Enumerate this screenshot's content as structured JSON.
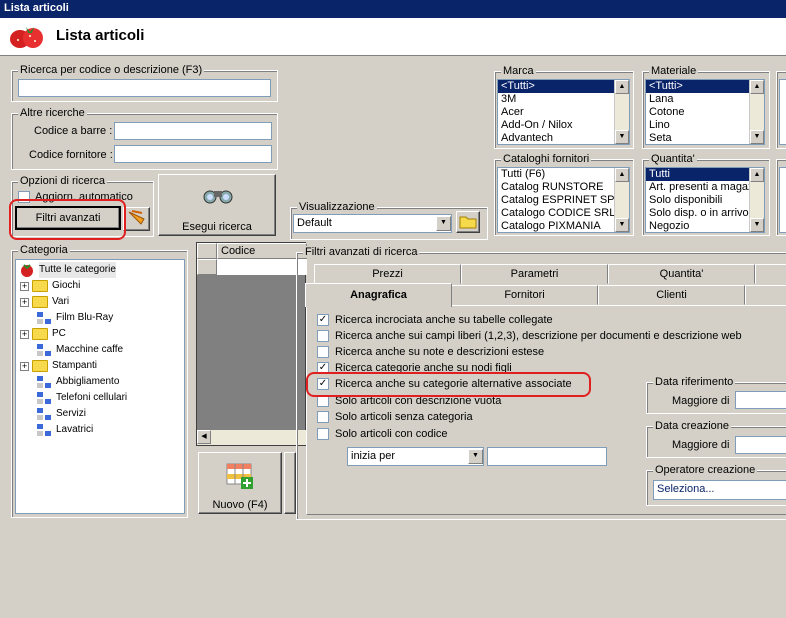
{
  "window": {
    "title": "Lista articoli"
  },
  "header": {
    "title": "Lista articoli"
  },
  "search": {
    "legend": "Ricerca per codice o descrizione (F3)",
    "value": ""
  },
  "altre": {
    "legend": "Altre ricerche",
    "barcode_label": "Codice a barre :",
    "supplier_label": "Codice fornitore :"
  },
  "opzioni": {
    "legend": "Opzioni di ricerca",
    "auto_update": "Aggiorn. automatico",
    "filtri_button": "Filtri avanzati"
  },
  "actions": {
    "esegui": "Esegui ricerca",
    "nuovo": "Nuovo (F4)"
  },
  "visual": {
    "legend": "Visualizzazione",
    "value": "Default"
  },
  "marca": {
    "legend": "Marca",
    "items": [
      "<Tutti>",
      "3M",
      "Acer",
      "Add-On / Nilox",
      "Advantech"
    ]
  },
  "materiale": {
    "legend": "Materiale",
    "items": [
      "<Tutti>",
      "Lana",
      "Cotone",
      "Lino",
      "Seta"
    ]
  },
  "cataloghi": {
    "legend": "Cataloghi fornitori",
    "items": [
      "Tutti (F6)",
      "Catalog RUNSTORE",
      "Catalog ESPRINET SP",
      "Catalogo CODICE SRL",
      "Catalogo PIXMANIA"
    ]
  },
  "quantita": {
    "legend": "Quantita'",
    "items": [
      "Tutti",
      "Art. presenti a magaz",
      "Solo disponibili",
      "Solo disp. o in arrivo",
      "Negozio"
    ]
  },
  "categoria": {
    "legend": "Categoria",
    "root": "Tutte le categorie",
    "items": [
      "Giochi",
      "Vari",
      "Film Blu-Ray",
      "PC",
      "Macchine caffe",
      "Stampanti",
      "Abbigliamento",
      "Telefoni cellulari",
      "Servizi",
      "Lavatrici"
    ]
  },
  "grid": {
    "col_codice": "Codice"
  },
  "filtri": {
    "legend": "Filtri avanzati di ricerca",
    "tabs_back": [
      "Prezzi",
      "Parametri",
      "Quantita'"
    ],
    "tabs_front": [
      "Anagrafica",
      "Fornitori",
      "Clienti"
    ],
    "options": [
      {
        "label": "Ricerca incrociata anche su tabelle collegate",
        "checked": true
      },
      {
        "label": "Ricerca anche sui campi liberi (1,2,3), descrizione per documenti e descrizione web",
        "checked": false
      },
      {
        "label": "Ricerca anche su note e descrizioni estese",
        "checked": false
      },
      {
        "label": "Ricerca categorie anche su nodi figli",
        "checked": true
      },
      {
        "label": "Ricerca anche su categorie alternative associate",
        "checked": true
      },
      {
        "label": "Solo articoli con descrizione vuota",
        "checked": false
      },
      {
        "label": "Solo articoli senza categoria",
        "checked": false
      },
      {
        "label": "Solo articoli con codice",
        "checked": false
      }
    ],
    "match_mode": "inizia per",
    "data_riferimento": {
      "legend": "Data riferimento",
      "label": "Maggiore di"
    },
    "data_creazione": {
      "legend": "Data creazione",
      "label": "Maggiore di"
    },
    "operatore": {
      "legend": "Operatore creazione",
      "value": "Seleziona..."
    }
  }
}
